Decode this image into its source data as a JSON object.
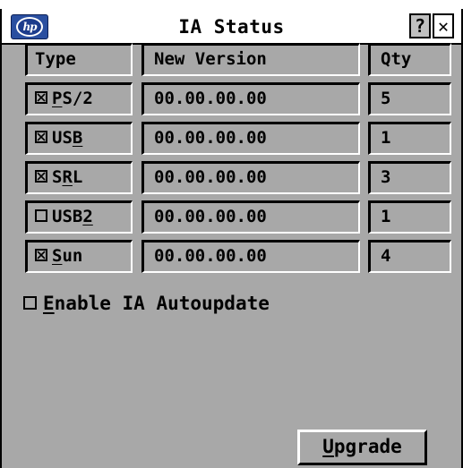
{
  "window": {
    "title": "IA Status",
    "help_label": "?",
    "close_label": "✕"
  },
  "table": {
    "headers": {
      "type": "Type",
      "version": "New Version",
      "qty": "Qty"
    },
    "rows": [
      {
        "type_pre": "",
        "type_ul": "P",
        "type_post": "S/2",
        "checked": true,
        "version": "00.00.00.00",
        "qty": "5"
      },
      {
        "type_pre": "US",
        "type_ul": "B",
        "type_post": "",
        "checked": true,
        "version": "00.00.00.00",
        "qty": "1"
      },
      {
        "type_pre": "S",
        "type_ul": "R",
        "type_post": "L",
        "checked": true,
        "version": "00.00.00.00",
        "qty": "3"
      },
      {
        "type_pre": "USB",
        "type_ul": "2",
        "type_post": "",
        "checked": false,
        "version": "00.00.00.00",
        "qty": "1"
      },
      {
        "type_pre": "",
        "type_ul": "S",
        "type_post": "un",
        "checked": true,
        "version": "00.00.00.00",
        "qty": "4"
      }
    ]
  },
  "autoupdate": {
    "checked": false,
    "label_ul": "E",
    "label_rest": "nable IA Autoupdate"
  },
  "upgrade_button": {
    "label_ul": "U",
    "label_rest": "pgrade"
  }
}
